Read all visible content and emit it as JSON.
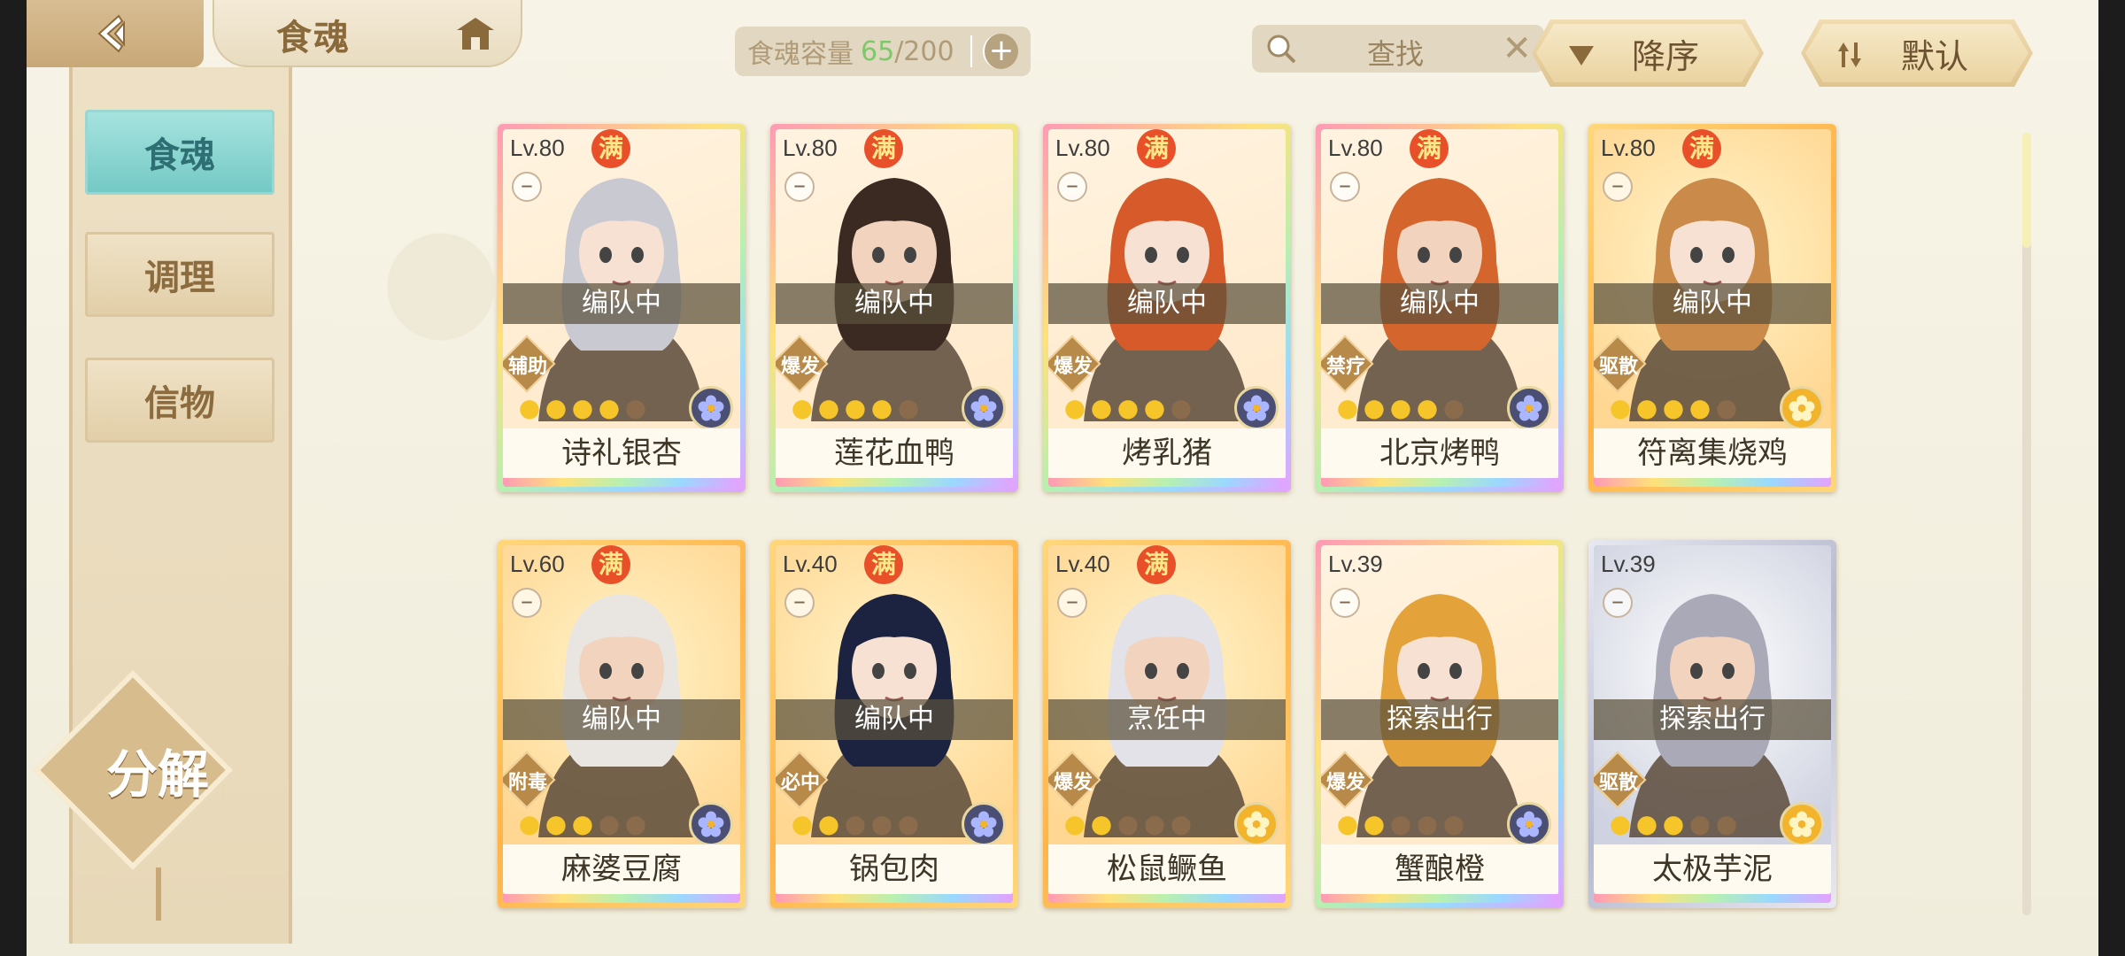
{
  "header": {
    "title": "食魂",
    "capacity_label": "食魂容量",
    "capacity_current": "65",
    "capacity_max": "/200",
    "search_label": "查找",
    "sort_order_label": "降序",
    "sort_mode_label": "默认"
  },
  "sidebar": {
    "items": [
      {
        "label": "食魂",
        "active": true
      },
      {
        "label": "调理",
        "active": false
      },
      {
        "label": "信物",
        "active": false
      }
    ],
    "decompose_label": "分解"
  },
  "cards": [
    {
      "level": "Lv.80",
      "full": "满",
      "status": "编队中",
      "role": "辅助",
      "stars_on": 4,
      "stars_total": 5,
      "element": "purple",
      "name": "诗礼银杏",
      "frame": "rainbow"
    },
    {
      "level": "Lv.80",
      "full": "满",
      "status": "编队中",
      "role": "爆发",
      "stars_on": 4,
      "stars_total": 5,
      "element": "purple",
      "name": "莲花血鸭",
      "frame": "rainbow"
    },
    {
      "level": "Lv.80",
      "full": "满",
      "status": "编队中",
      "role": "爆发",
      "stars_on": 4,
      "stars_total": 5,
      "element": "purple",
      "name": "烤乳猪",
      "frame": "rainbow"
    },
    {
      "level": "Lv.80",
      "full": "满",
      "status": "编队中",
      "role": "禁疗",
      "stars_on": 4,
      "stars_total": 5,
      "element": "purple",
      "name": "北京烤鸭",
      "frame": "rainbow"
    },
    {
      "level": "Lv.80",
      "full": "满",
      "status": "编队中",
      "role": "驱散",
      "stars_on": 4,
      "stars_total": 5,
      "element": "yellow",
      "name": "符离集烧鸡",
      "frame": "gold"
    },
    {
      "level": "Lv.60",
      "full": "满",
      "status": "编队中",
      "role": "附毒",
      "stars_on": 3,
      "stars_total": 5,
      "element": "purple",
      "name": "麻婆豆腐",
      "frame": "gold"
    },
    {
      "level": "Lv.40",
      "full": "满",
      "status": "编队中",
      "role": "必中",
      "stars_on": 2,
      "stars_total": 5,
      "element": "purple",
      "name": "锅包肉",
      "frame": "gold"
    },
    {
      "level": "Lv.40",
      "full": "满",
      "status": "烹饪中",
      "role": "爆发",
      "stars_on": 2,
      "stars_total": 5,
      "element": "yellow",
      "name": "松鼠鳜鱼",
      "frame": "gold"
    },
    {
      "level": "Lv.39",
      "full": "",
      "status": "探索出行",
      "role": "爆发",
      "stars_on": 2,
      "stars_total": 5,
      "element": "purple",
      "name": "蟹酿橙",
      "frame": "rainbow"
    },
    {
      "level": "Lv.39",
      "full": "",
      "status": "探索出行",
      "role": "驱散",
      "stars_on": 3,
      "stars_total": 5,
      "element": "yellow",
      "name": "太极芋泥",
      "frame": "silver"
    }
  ],
  "colors": {
    "accent_teal": "#74c9c5",
    "gold": "#c8a877",
    "capacity_current": "#7dc86a",
    "full_badge": "#e8502a"
  }
}
